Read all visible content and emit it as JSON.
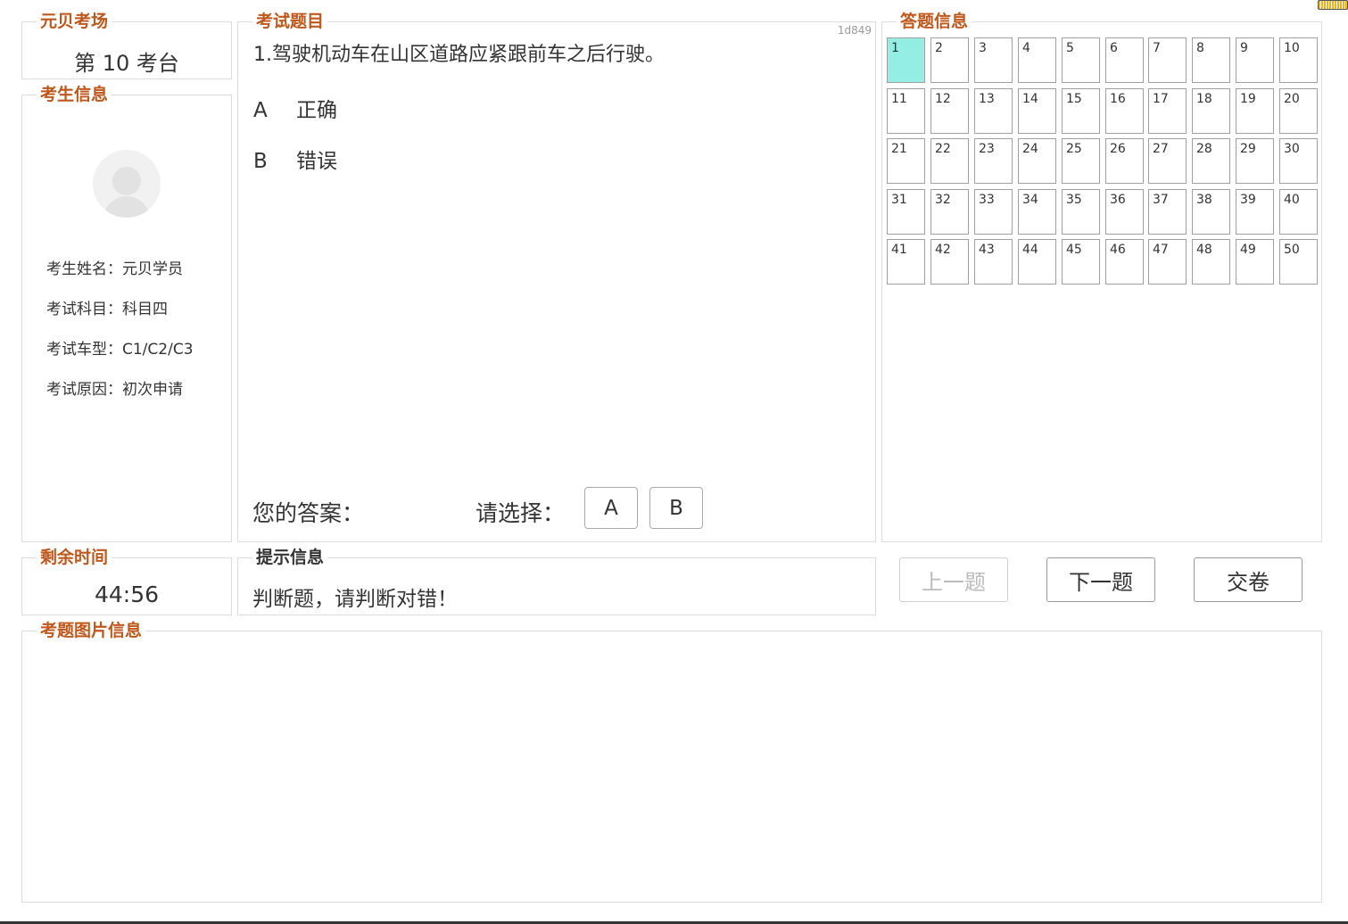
{
  "exam_room": {
    "title": "元贝考场",
    "room": "第 10 考台"
  },
  "candidate": {
    "title": "考生信息",
    "fields": [
      {
        "label": "考生姓名：",
        "value": "元贝学员"
      },
      {
        "label": "考试科目：",
        "value": "科目四"
      },
      {
        "label": "考试车型：",
        "value": "C1/C2/C3"
      },
      {
        "label": "考试原因：",
        "value": "初次申请"
      }
    ]
  },
  "question": {
    "title": "考试题目",
    "id": "1d849",
    "text": "1.驾驶机动车在山区道路应紧跟前车之后行驶。",
    "options": [
      {
        "letter": "A",
        "text": "正确"
      },
      {
        "letter": "B",
        "text": "错误"
      }
    ],
    "your_answer_label": "您的答案：",
    "select_label": "请选择：",
    "answer_buttons": [
      "A",
      "B"
    ]
  },
  "answer_info": {
    "title": "答题信息",
    "numbers": [
      "1",
      "2",
      "3",
      "4",
      "5",
      "6",
      "7",
      "8",
      "9",
      "10",
      "11",
      "12",
      "13",
      "14",
      "15",
      "16",
      "17",
      "18",
      "19",
      "20",
      "21",
      "22",
      "23",
      "24",
      "25",
      "26",
      "27",
      "28",
      "29",
      "30",
      "31",
      "32",
      "33",
      "34",
      "35",
      "36",
      "37",
      "38",
      "39",
      "40",
      "41",
      "42",
      "43",
      "44",
      "45",
      "46",
      "47",
      "48",
      "49",
      "50"
    ],
    "current": "1",
    "current_color": "#94eee3"
  },
  "timer": {
    "title": "剩余时间",
    "value": "44:56"
  },
  "hint": {
    "title": "提示信息",
    "text": "判断题，请判断对错！"
  },
  "nav": {
    "prev": "上一题",
    "next": "下一题",
    "submit": "交卷"
  },
  "image_info": {
    "title": "考题图片信息"
  },
  "colors": {
    "title_accent": "#c0571b"
  }
}
